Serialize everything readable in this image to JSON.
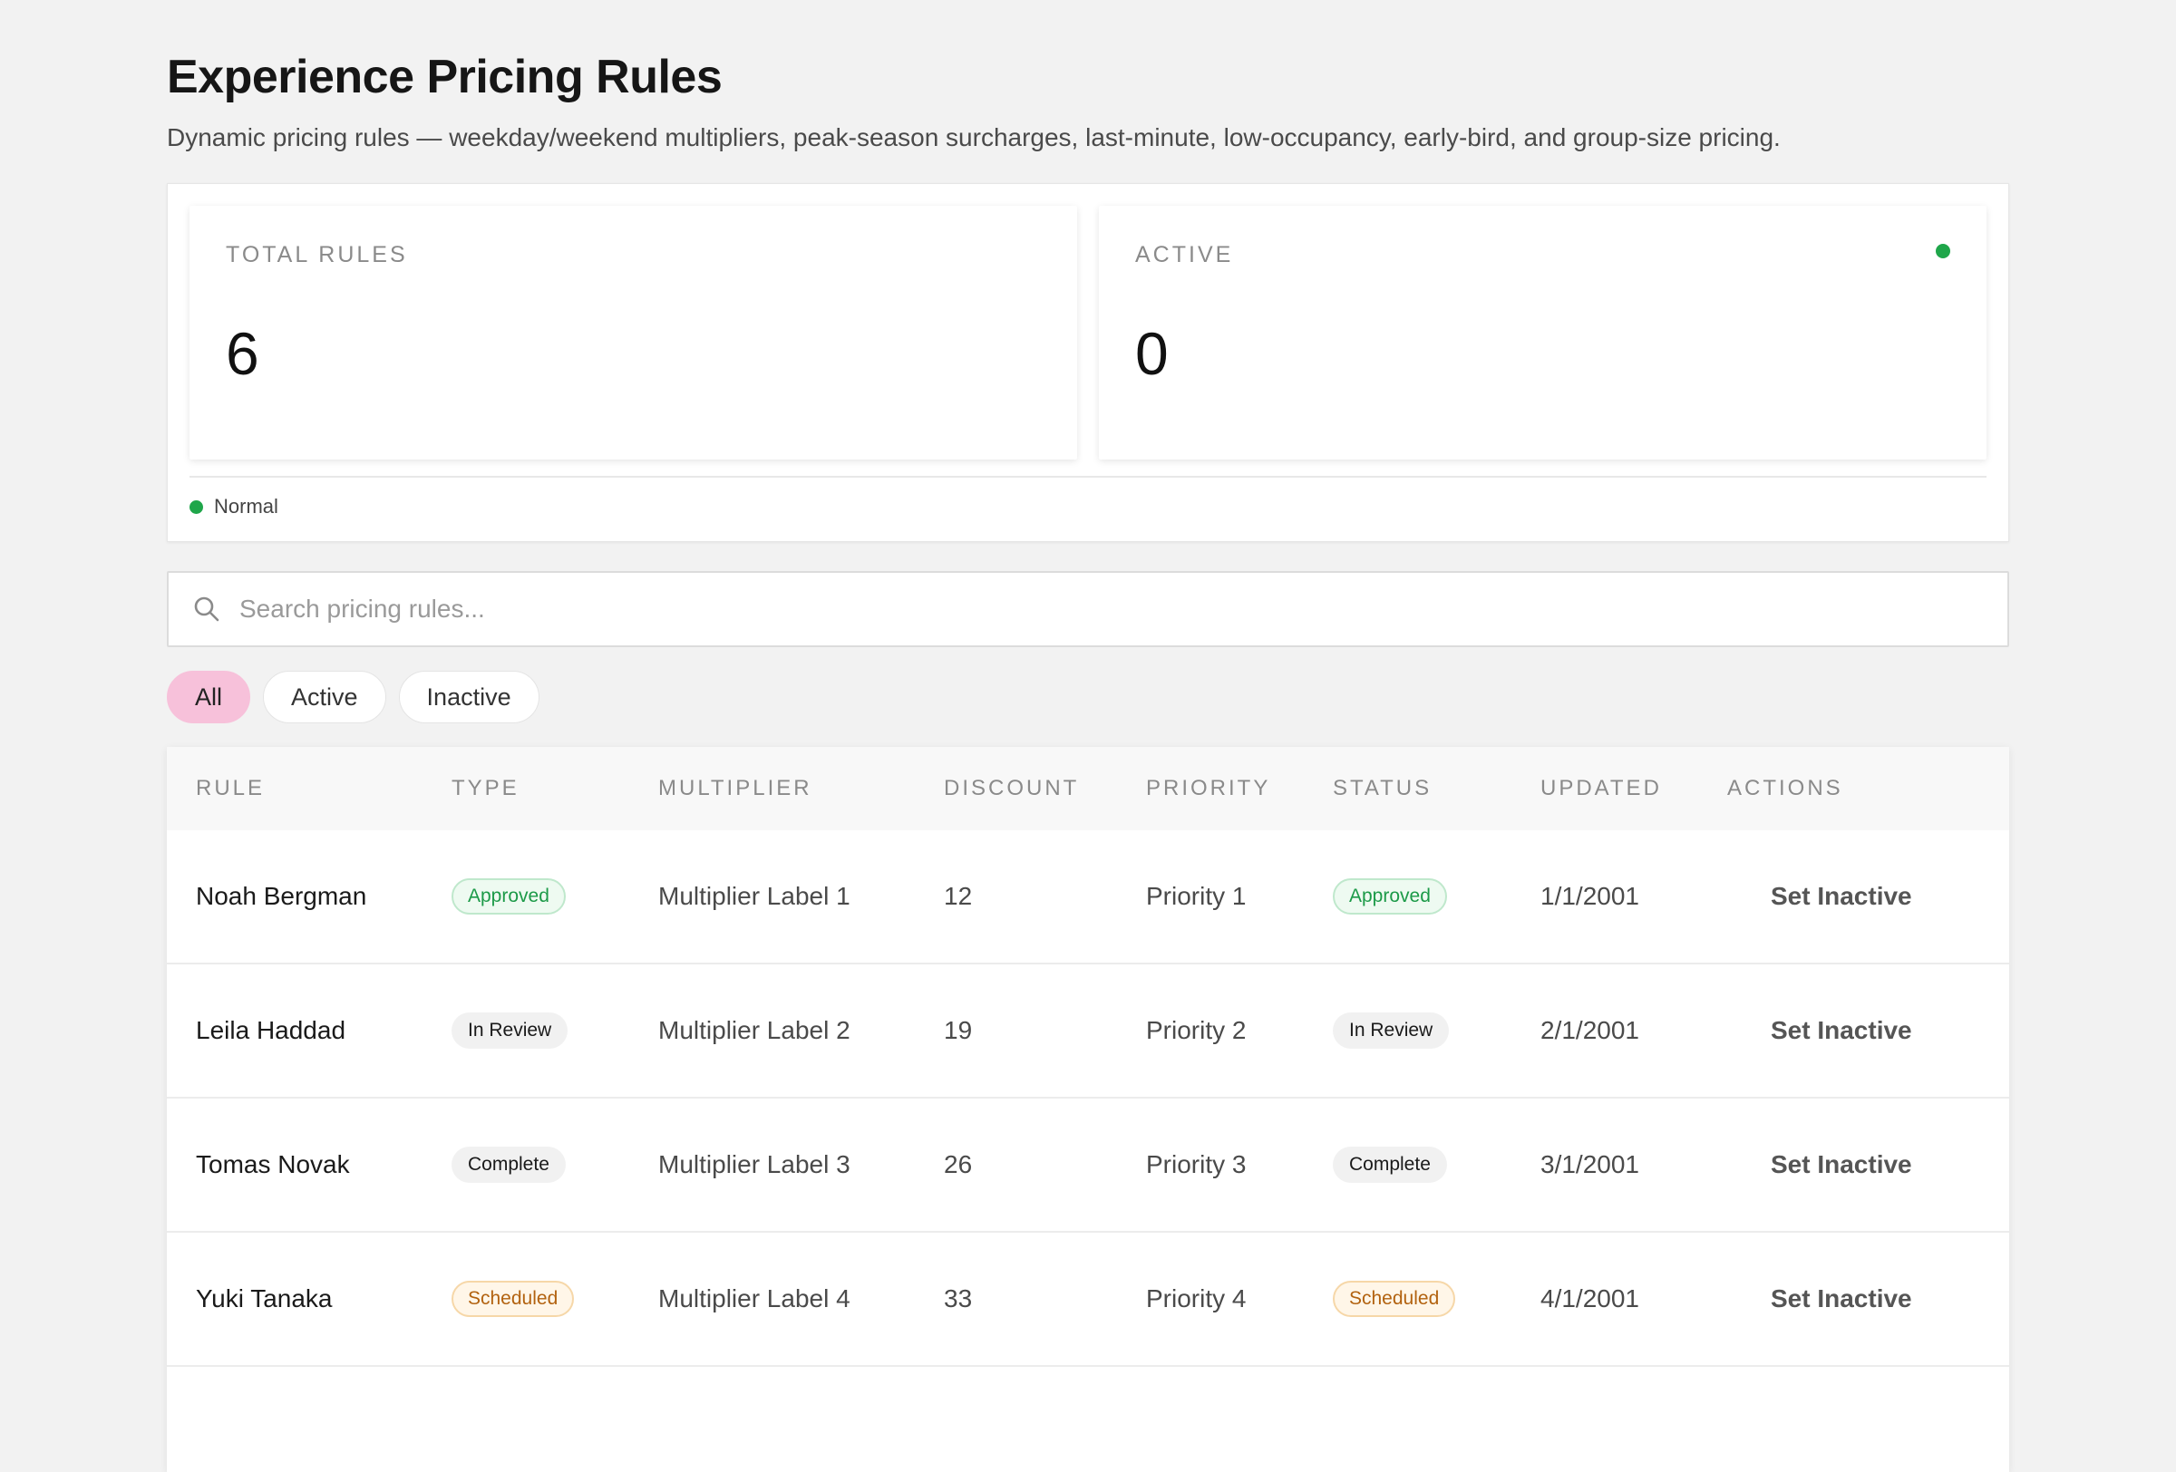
{
  "header": {
    "title": "Experience Pricing Rules",
    "subtitle": "Dynamic pricing rules — weekday/weekend multipliers, peak-season surcharges, last-minute, low-occupancy, early-bird, and group-size pricing."
  },
  "stats": {
    "total": {
      "label": "TOTAL RULES",
      "value": "6"
    },
    "active": {
      "label": "ACTIVE",
      "value": "0",
      "indicator_color": "#1fa64a"
    },
    "status_text": "Normal"
  },
  "search": {
    "placeholder": "Search pricing rules..."
  },
  "filters": [
    {
      "label": "All",
      "active": true
    },
    {
      "label": "Active",
      "active": false
    },
    {
      "label": "Inactive",
      "active": false
    }
  ],
  "table": {
    "columns": [
      "RULE",
      "TYPE",
      "MULTIPLIER",
      "DISCOUNT",
      "PRIORITY",
      "STATUS",
      "UPDATED",
      "ACTIONS"
    ],
    "rows": [
      {
        "rule": "Noah Bergman",
        "type": "Approved",
        "multiplier": "Multiplier Label 1",
        "discount": "12",
        "priority": "Priority 1",
        "status": "Approved",
        "updated": "1/1/2001",
        "action": "Set Inactive"
      },
      {
        "rule": "Leila Haddad",
        "type": "In Review",
        "multiplier": "Multiplier Label 2",
        "discount": "19",
        "priority": "Priority 2",
        "status": "In Review",
        "updated": "2/1/2001",
        "action": "Set Inactive"
      },
      {
        "rule": "Tomas Novak",
        "type": "Complete",
        "multiplier": "Multiplier Label 3",
        "discount": "26",
        "priority": "Priority 3",
        "status": "Complete",
        "updated": "3/1/2001",
        "action": "Set Inactive"
      },
      {
        "rule": "Yuki Tanaka",
        "type": "Scheduled",
        "multiplier": "Multiplier Label 4",
        "discount": "33",
        "priority": "Priority 4",
        "status": "Scheduled",
        "updated": "4/1/2001",
        "action": "Set Inactive"
      }
    ]
  },
  "colors": {
    "accent_pink": "#f7c1da",
    "approved_green": "#1c9a48",
    "scheduled_orange": "#b2620f"
  }
}
